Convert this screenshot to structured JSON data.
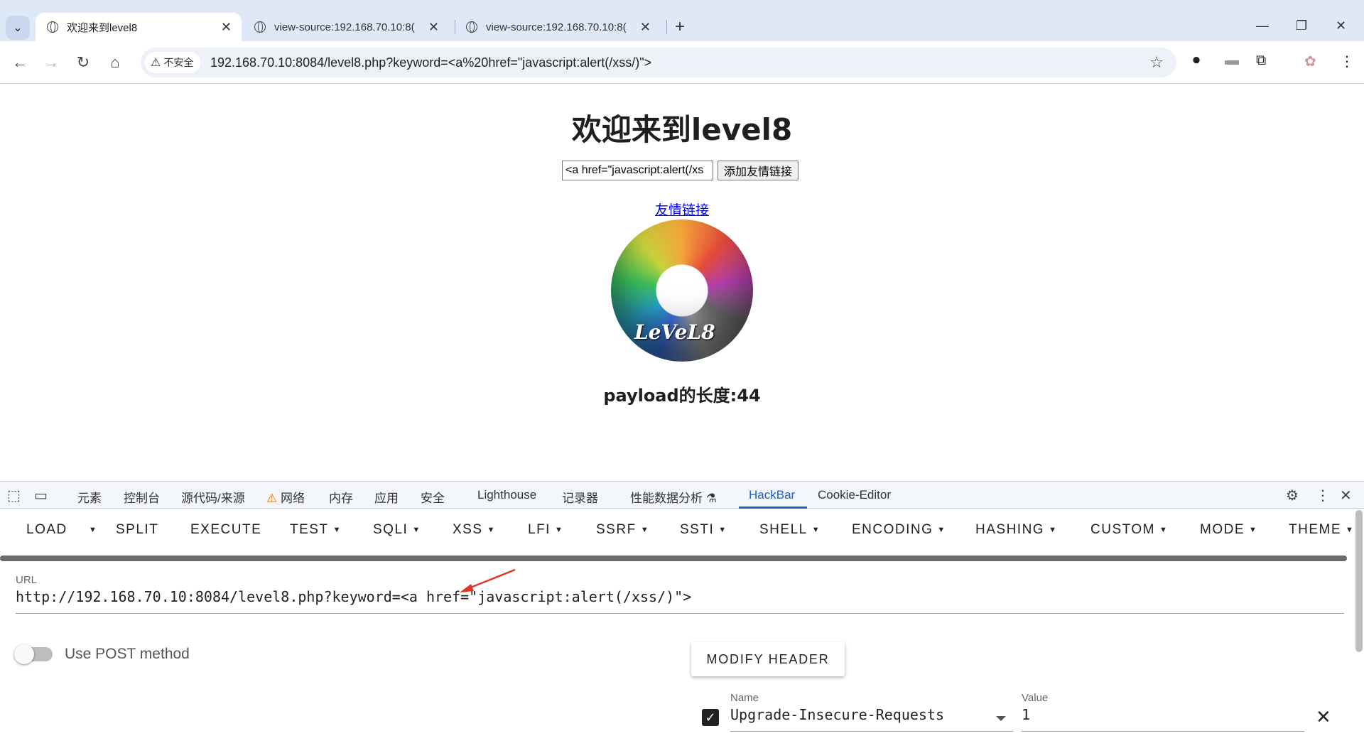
{
  "browser": {
    "tabs": [
      {
        "title": "欢迎来到level8"
      },
      {
        "title": "view-source:192.168.70.10:8("
      },
      {
        "title": "view-source:192.168.70.10:8("
      }
    ],
    "security_label": "不安全",
    "address": "192.168.70.10:8084/level8.php?keyword=<a%20href=\"javascript:alert(/xss/)\">"
  },
  "page": {
    "heading": "欢迎来到level8",
    "search_value": "<a href=\"javascript:alert(/xs",
    "submit_label": "添加友情链接",
    "friend_link": "友情链接",
    "disc_label": "LeVeL8",
    "payload_length": "payload的长度:44"
  },
  "devtools": {
    "tabs": [
      "元素",
      "控制台",
      "源代码/来源",
      "网络",
      "内存",
      "应用",
      "安全",
      "Lighthouse",
      "记录器",
      "性能数据分析",
      "HackBar",
      "Cookie-Editor"
    ],
    "active_tab": "HackBar"
  },
  "hackbar": {
    "menu": [
      "LOAD",
      "SPLIT",
      "EXECUTE",
      "TEST",
      "SQLI",
      "XSS",
      "LFI",
      "SSRF",
      "SSTI",
      "SHELL",
      "ENCODING",
      "HASHING",
      "CUSTOM",
      "MODE",
      "THEME"
    ],
    "url_label": "URL",
    "url_value": "http://192.168.70.10:8084/level8.php?keyword=<a href=\"javascript:alert(/xss/)\">",
    "post_label": "Use POST method",
    "post_enabled": false,
    "modify_header_label": "MODIFY HEADER",
    "header": {
      "enabled": true,
      "name_label": "Name",
      "name_value": "Upgrade-Insecure-Requests",
      "value_label": "Value",
      "value_value": "1"
    }
  },
  "colors": {
    "chrome_bg": "#dfe8f6",
    "link": "#0000ee",
    "devtools_accent": "#1a63c7",
    "arrow": "#e0342a"
  }
}
